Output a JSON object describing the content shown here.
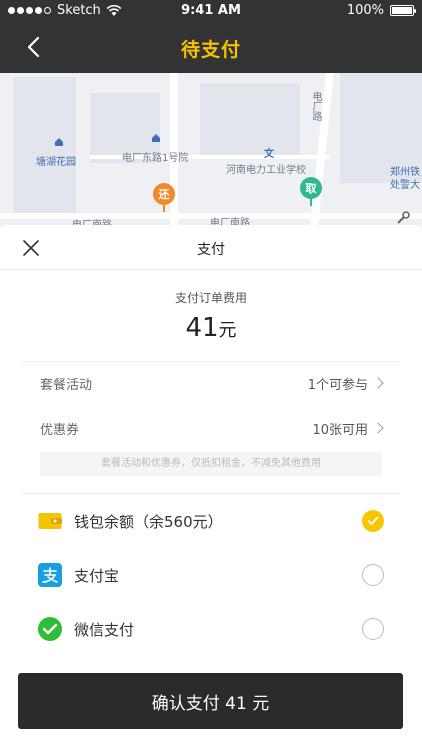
{
  "status_bar": {
    "carrier": "Sketch",
    "time": "9:41 AM",
    "battery": "100%"
  },
  "nav": {
    "title": "待支付"
  },
  "map": {
    "labels": {
      "road_top_right": "电厂路",
      "poi_1": "塘湖花园",
      "poi_2": "电厂东路1号院",
      "poi_school_icon": "文",
      "poi_school": "河南电力工业学校",
      "poi_right": "郑州铁",
      "poi_right_2": "处警大",
      "road_bottom_left": "电厂南路",
      "road_bottom_mid": "电厂南路"
    },
    "pins": {
      "return_pin": "还",
      "pickup_pin": "取"
    }
  },
  "sheet": {
    "title": "支付",
    "fee_label": "支付订单费用",
    "fee_value": "41",
    "fee_unit": "元",
    "package_label": "套餐活动",
    "package_value": "1个可参与",
    "coupon_label": "优惠券",
    "coupon_value": "10张可用",
    "notice": "套餐活动和优惠券，仅抵扣租金，不减免其他费用",
    "payment_methods": [
      {
        "label": "钱包余额（余560元）",
        "selected": true,
        "icon": "wallet-icon"
      },
      {
        "label": "支付宝",
        "selected": false,
        "icon": "alipay-icon"
      },
      {
        "label": "微信支付",
        "selected": false,
        "icon": "wechat-icon"
      }
    ],
    "confirm_label": "确认支付 41 元"
  },
  "colors": {
    "accent": "#f5c400",
    "dark": "#333333",
    "alipay": "#1a9ee3",
    "wechat": "#2fbd37"
  }
}
